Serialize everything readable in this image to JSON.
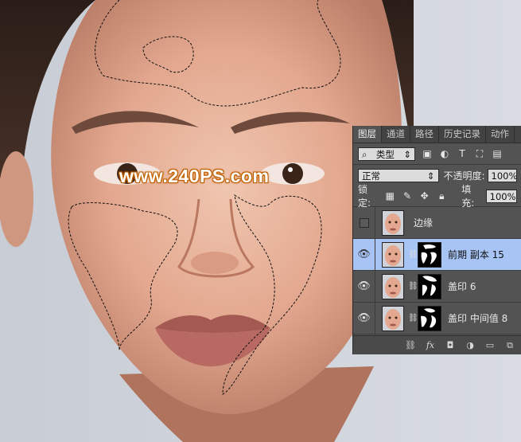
{
  "watermark": "www.240PS.com",
  "panel": {
    "tabs": [
      "图层",
      "通道",
      "路径",
      "历史记录",
      "动作"
    ],
    "filter_kind": "类型",
    "blend_mode": "正常",
    "opacity_label": "不透明度:",
    "opacity_value": "100%",
    "lock_label": "锁定:",
    "fill_label": "填充:",
    "fill_value": "100%",
    "layers": [
      {
        "name": "边缘",
        "visible": false,
        "has_mask": false,
        "selected": false
      },
      {
        "name": "前期 副本 15",
        "visible": true,
        "has_mask": true,
        "selected": true
      },
      {
        "name": "盖印 6",
        "visible": true,
        "has_mask": true,
        "selected": false
      },
      {
        "name": "盖印 中间值 8",
        "visible": true,
        "has_mask": true,
        "selected": false
      }
    ]
  },
  "colors": {
    "panel_bg": "#535353",
    "selected_layer": "#a8c4f4",
    "watermark_stroke": "#c86400"
  }
}
